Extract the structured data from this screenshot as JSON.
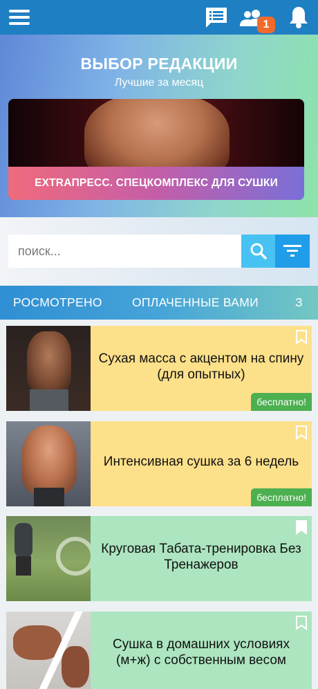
{
  "header": {
    "menu_icon": "hamburger-menu-icon",
    "chat_icon": "chat-list-icon",
    "users_icon": "users-icon",
    "users_badge": "1",
    "bell_icon": "bell-icon",
    "colors": {
      "bar": "#1f7fc3",
      "badge": "#f26a2a"
    }
  },
  "editors_pick": {
    "title": "ВЫБОР РЕДАКЦИИ",
    "subtitle": "Лучшие за месяц",
    "featured_title": "EXTRAПРЕСС. СПЕЦКОМПЛЕКС ДЛЯ СУШКИ"
  },
  "search": {
    "placeholder": "поиск...",
    "value": "",
    "search_icon": "search-icon",
    "filter_icon": "filter-icon"
  },
  "tabs": [
    {
      "label": "РОСМОТРЕНО"
    },
    {
      "label": "ОПЛАЧЕННЫЕ ВАМИ"
    },
    {
      "label": "З"
    }
  ],
  "programs": [
    {
      "title": "Сухая масса с акцентом на спину (для опытных)",
      "badge": "бесплатно!",
      "color": "#fde08a"
    },
    {
      "title": "Интенсивная сушка за 6 недель",
      "badge": "бесплатно!",
      "color": "#fde08a"
    },
    {
      "title": "Круговая Табата-тренировка Без Тренажеров",
      "badge": "",
      "color": "#ace5bf"
    },
    {
      "title": "Сушка в домашних условиях (м+ж) с собственным весом",
      "badge": "",
      "color": "#ace5bf"
    }
  ]
}
